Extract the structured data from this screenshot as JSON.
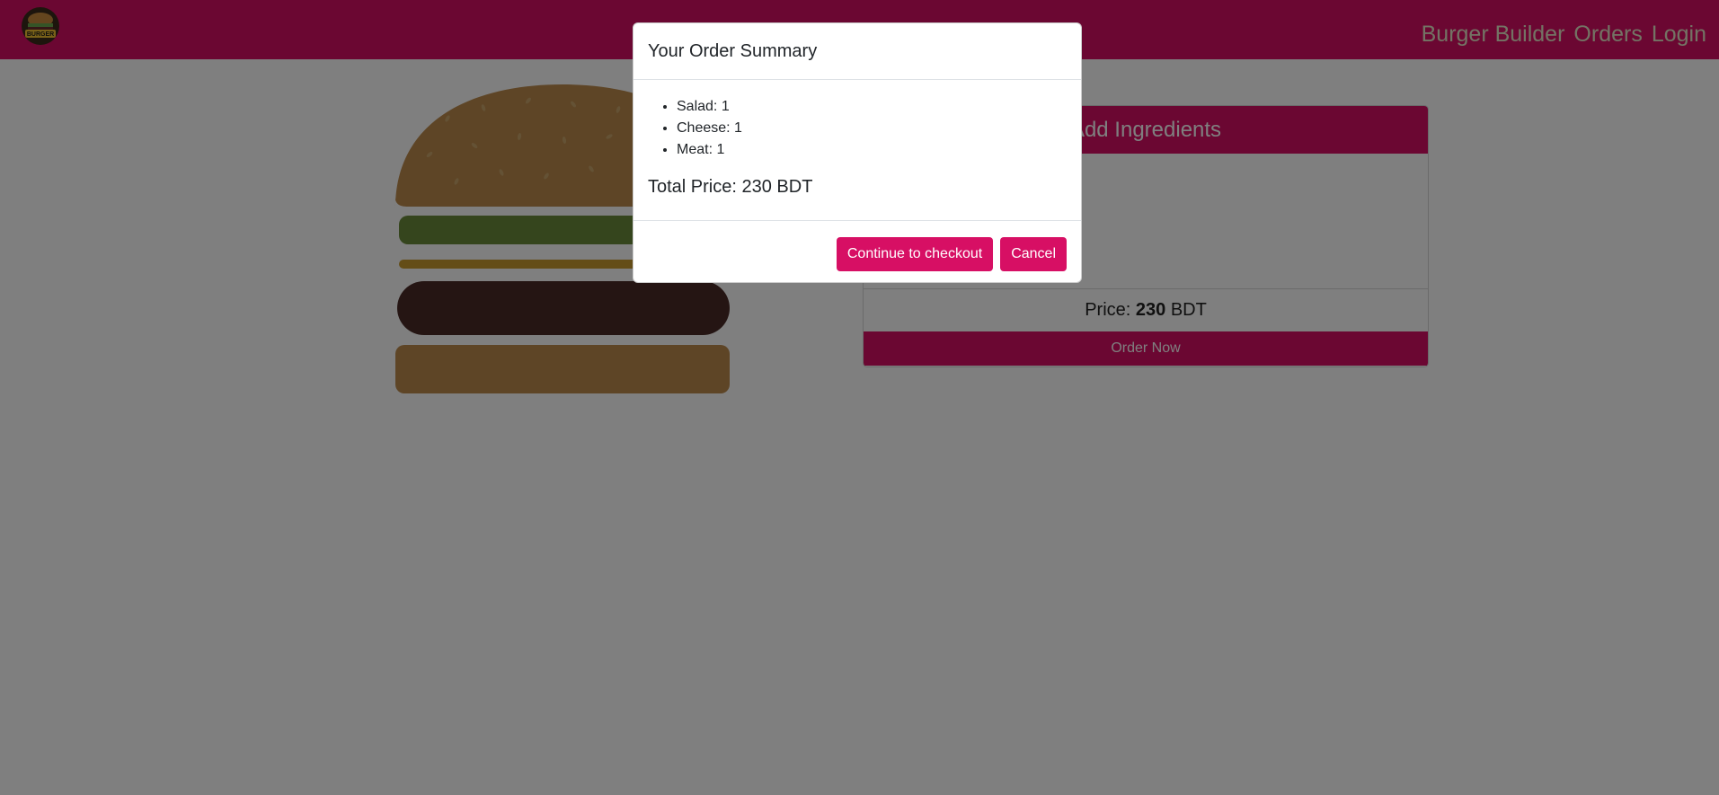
{
  "nav": {
    "links": [
      "Burger Builder",
      "Orders",
      "Login"
    ],
    "logo_icon": "burger-logo-icon",
    "logo_text": "BURGER"
  },
  "controls": {
    "header": "Add Ingredients",
    "price_label": "Price:",
    "price_value": "230",
    "price_currency": "BDT",
    "order_button": "Order Now"
  },
  "modal": {
    "title": "Your Order Summary",
    "items": [
      "Salad: 1",
      "Cheese: 1",
      "Meat: 1"
    ],
    "total": "Total Price: 230 BDT",
    "checkout_button": "Continue to checkout",
    "cancel_button": "Cancel"
  },
  "colors": {
    "brand": "#d70f64",
    "nav_text": "#e7e7c8",
    "bun": "#c99c53",
    "salad": "#8bc34a",
    "cheese": "#f4d004",
    "meat": "#6b2f2f",
    "backdrop": "rgba(0,0,0,0.5)"
  }
}
